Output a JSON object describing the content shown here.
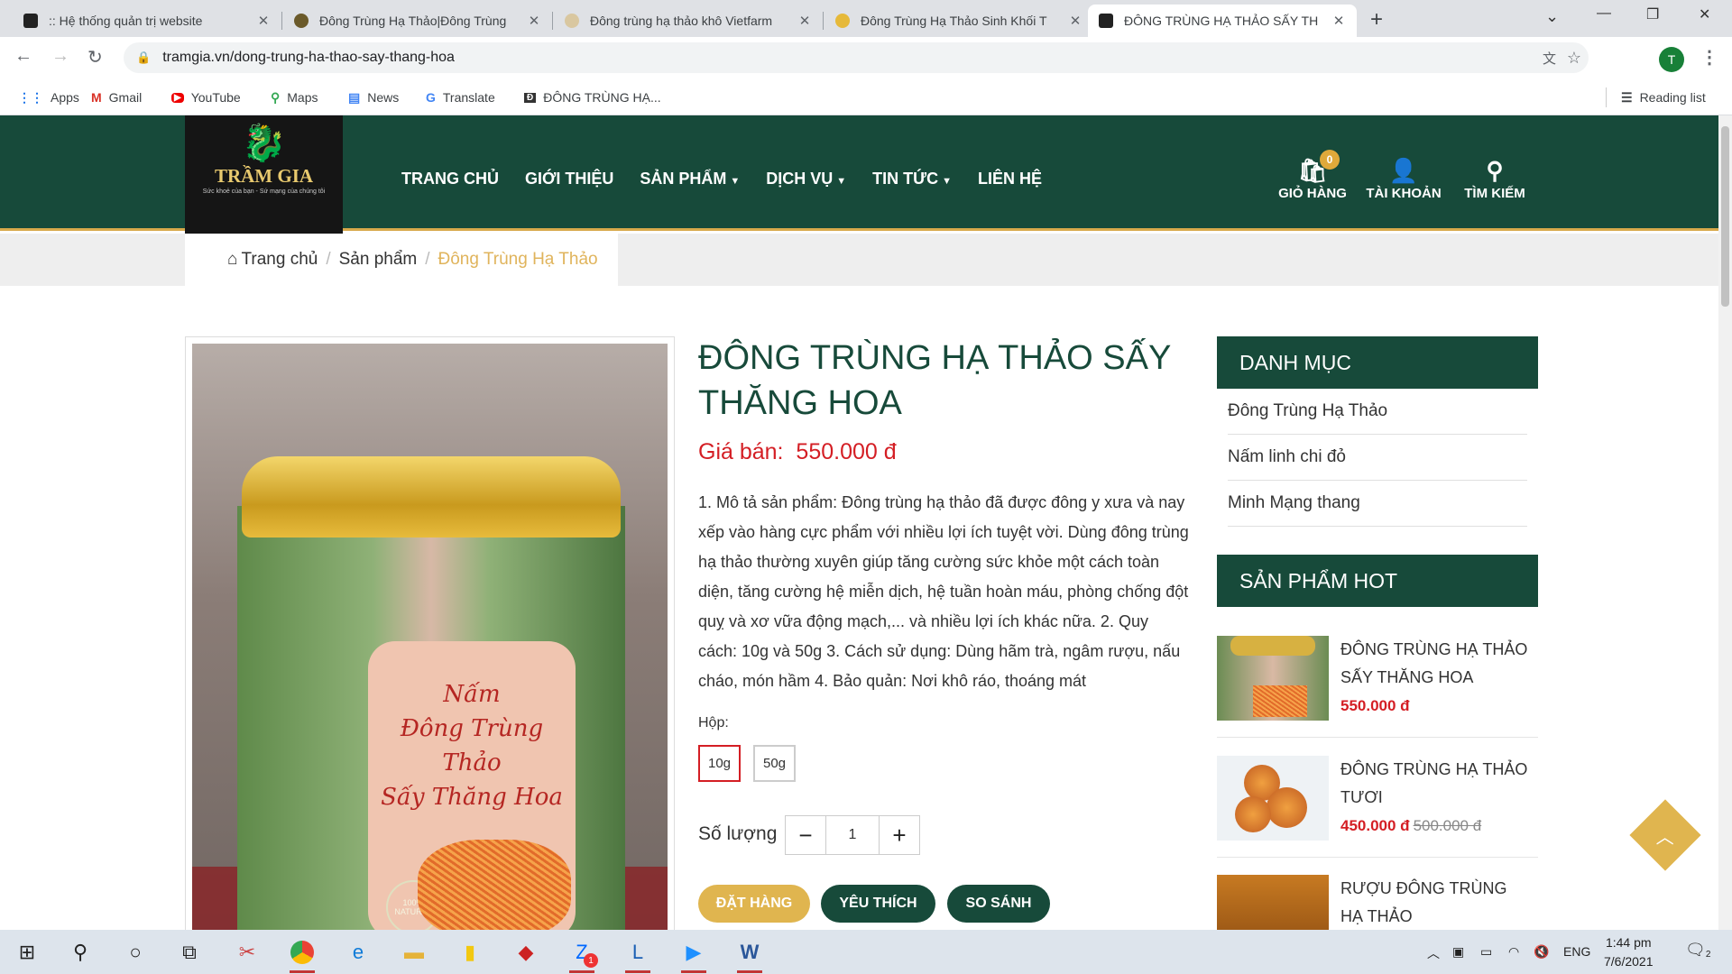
{
  "browser": {
    "tabs": [
      {
        "title": ":: Hệ thống quản trị website",
        "favicon_color": "#222222"
      },
      {
        "title": "Đông Trùng Hạ Thảo|Đông Trùng",
        "favicon_color": "#6b5a2a"
      },
      {
        "title": "Đông trùng hạ thảo khô Vietfarm",
        "favicon_color": "#d9c7a0"
      },
      {
        "title": "Đông Trùng Hạ Thảo Sinh Khối T",
        "favicon_color": "#e6b93a"
      },
      {
        "title": "ĐÔNG TRÙNG HẠ THẢO SẤY TH",
        "favicon_color": "#222222"
      }
    ],
    "url": "tramgia.vn/dong-trung-ha-thao-say-thang-hoa",
    "profile_initial": "T",
    "bookmarks": [
      {
        "label": "Apps",
        "icon": "apps-grid-icon"
      },
      {
        "label": "Gmail",
        "icon": "gmail-icon"
      },
      {
        "label": "YouTube",
        "icon": "youtube-icon"
      },
      {
        "label": "Maps",
        "icon": "maps-icon"
      },
      {
        "label": "News",
        "icon": "news-icon"
      },
      {
        "label": "Translate",
        "icon": "translate-icon"
      },
      {
        "label": "ĐÔNG TRÙNG HẠ...",
        "icon": "site-icon"
      }
    ],
    "reading_list": "Reading list"
  },
  "site": {
    "logo_name": "TRẦM GIA",
    "logo_slogan": "Sức khoẻ của bạn - Sứ mạng của chúng tôi",
    "nav": [
      {
        "label": "TRANG CHỦ",
        "dropdown": false
      },
      {
        "label": "GIỚI THIỆU",
        "dropdown": false
      },
      {
        "label": "SẢN PHẨM",
        "dropdown": true
      },
      {
        "label": "DỊCH VỤ",
        "dropdown": true
      },
      {
        "label": "TIN TỨC",
        "dropdown": true
      },
      {
        "label": "LIÊN HỆ",
        "dropdown": false
      }
    ],
    "cart_label": "GIỎ HÀNG",
    "cart_count": "0",
    "account_label": "TÀI KHOẢN",
    "search_label": "TÌM KIẾM",
    "colors": {
      "primary": "#174a3a",
      "accent": "#e0b54f",
      "price": "#d41e24"
    }
  },
  "breadcrumb": {
    "home": "Trang chủ",
    "level1": "Sản phẩm",
    "current": "Đông Trùng Hạ Thảo"
  },
  "product": {
    "title": "ĐÔNG TRÙNG HẠ THẢO SẤY THĂNG HOA",
    "price_label": "Giá bán:",
    "price": "550.000 đ",
    "description": "1. Mô tả sản phẩm: Đông trùng hạ thảo đã được đông y xưa và nay xếp vào hàng cực phẩm với nhiều lợi ích tuyệt vời. Dùng đông trùng hạ thảo thường xuyên giúp tăng cường sức khỏe một cách toàn diện, tăng cường hệ miễn dịch, hệ tuần hoàn máu, phòng chống đột quỵ và xơ vữa động mạch,... và nhiều lợi ích khác nữa. 2. Quy cách: 10g và 50g 3. Cách sử dụng: Dùng hãm trà, ngâm rượu, nấu cháo, món hầm 4. Bảo quản: Nơi khô ráo, thoáng mát",
    "option_label": "Hộp:",
    "options": [
      "10g",
      "50g"
    ],
    "selected_option": "10g",
    "qty_label": "Số lượng",
    "qty_value": "1",
    "buttons": {
      "order": "ĐẶT HÀNG",
      "wishlist": "YÊU THÍCH",
      "compare": "SO SÁNH"
    },
    "image_label_text": [
      "Nấm",
      "Đông Trùng Thảo",
      "Sấy Thăng Hoa"
    ],
    "image_badge": "100% NATURAL"
  },
  "sidebar": {
    "categories_title": "DANH MỤC",
    "categories": [
      "Đông Trùng Hạ Thảo",
      "Nấm linh chi đỏ",
      "Minh Mạng thang"
    ],
    "hot_title": "SẢN PHẨM HOT",
    "hot": [
      {
        "name": "ĐÔNG TRÙNG HẠ THẢO SẤY THĂNG HOA",
        "price": "550.000 đ",
        "old_price": ""
      },
      {
        "name": "ĐÔNG TRÙNG HẠ THẢO TƯƠI",
        "price": "450.000 đ",
        "old_price": "500.000 đ"
      },
      {
        "name": "RƯỢU ĐÔNG TRÙNG HẠ THẢO",
        "price": "",
        "old_price": ""
      }
    ]
  },
  "taskbar": {
    "apps": [
      "windows-start-icon",
      "search-icon",
      "cortana-icon",
      "task-view-icon",
      "snipping-icon",
      "chrome-icon",
      "edge-icon",
      "file-explorer-icon",
      "powerbi-icon",
      "app-icon",
      "zalo-icon",
      "lync-icon",
      "media-icon",
      "word-icon"
    ],
    "zalo_badge": "1",
    "language": "ENG",
    "time": "1:44 pm",
    "date": "7/6/2021",
    "notification_count": "2"
  }
}
